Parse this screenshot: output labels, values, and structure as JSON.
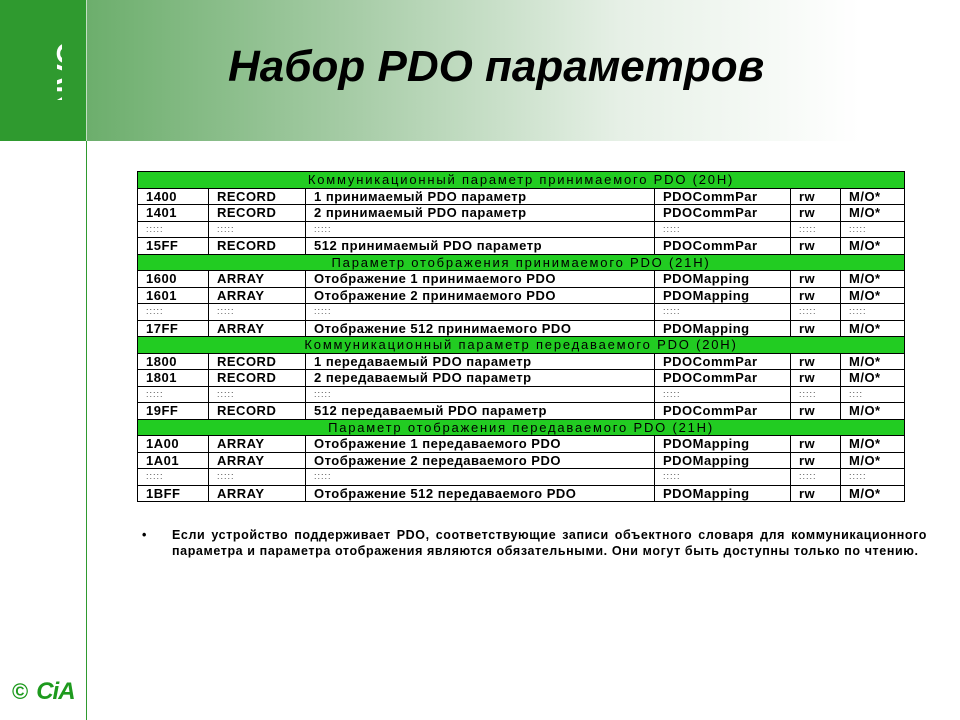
{
  "slide": {
    "title": "Набор PDO параметров",
    "logo_text": "CAN",
    "copyright": "©",
    "footer_logo": "CiA",
    "colors": {
      "accent_green": "#2f9a2f",
      "section_green": "#22cc22"
    }
  },
  "sections": [
    {
      "header": "Коммуникационный параметр принимаемого PDO (20H)",
      "rows": [
        [
          "1400",
          "RECORD",
          "1 принимаемый PDO параметр",
          "PDOCommPar",
          "rw",
          "M/O*"
        ],
        [
          "1401",
          "RECORD",
          "2 принимаемый PDO параметр",
          "PDOCommPar",
          "rw",
          "M/O*"
        ],
        [
          ":::::",
          ":::::",
          ":::::",
          ":::::",
          ":::::",
          ":::::"
        ],
        [
          "15FF",
          "RECORD",
          "512 принимаемый PDO параметр",
          "PDOCommPar",
          "rw",
          "M/O*"
        ]
      ]
    },
    {
      "header": "Параметр отображения принимаемого PDO (21H)",
      "rows": [
        [
          "1600",
          "ARRAY",
          "Отображение 1 принимаемого PDO",
          "PDOMapping",
          "rw",
          "M/O*"
        ],
        [
          "1601",
          "ARRAY",
          "Отображение 2 принимаемого PDO",
          "PDOMapping",
          "rw",
          "M/O*"
        ],
        [
          ":::::",
          ":::::",
          ":::::",
          ":::::",
          ":::::",
          ":::::"
        ],
        [
          "17FF",
          "ARRAY",
          "Отображение 512 принимаемого PDO",
          "PDOMapping",
          "rw",
          "M/O*"
        ]
      ]
    },
    {
      "header": "Коммуникационный параметр передаваемого PDO (20H)",
      "rows": [
        [
          "1800",
          "RECORD",
          "1 передаваемый PDO параметр",
          "PDOCommPar",
          "rw",
          "M/O*"
        ],
        [
          "1801",
          "RECORD",
          "2 передаваемый PDO параметр",
          "PDOCommPar",
          "rw",
          "M/O*"
        ],
        [
          ":::::",
          ":::::",
          ":::::",
          ":::::",
          ":::::",
          "::::"
        ],
        [
          "19FF",
          "RECORD",
          "512 передаваемый PDO параметр",
          "PDOCommPar",
          "rw",
          "M/O*"
        ]
      ]
    },
    {
      "header": "Параметр отображения передаваемого PDO (21H)",
      "rows": [
        [
          "1A00",
          "ARRAY",
          "Отображение 1 передаваемого PDO",
          "PDOMapping",
          "rw",
          "M/O*"
        ],
        [
          "1A01",
          "ARRAY",
          "Отображение 2 передаваемого PDO",
          "PDOMapping",
          "rw",
          "M/O*"
        ],
        [
          ":::::",
          ":::::",
          ":::::",
          ":::::",
          ":::::",
          ":::::"
        ],
        [
          "1BFF",
          "ARRAY",
          "Отображение 512 передаваемого PDO",
          "PDOMapping",
          "rw",
          "M/O*"
        ]
      ]
    }
  ],
  "note": {
    "bullet": "•",
    "text": "Если устройство поддерживает PDO, соответствующие записи объектного словаря для коммуникационного параметра и параметра отображения являются обязательными. Они могут быть доступны только по чтению."
  }
}
